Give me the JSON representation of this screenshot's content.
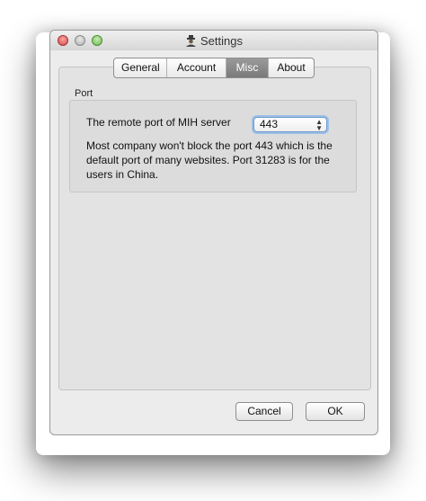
{
  "window": {
    "title": "Settings",
    "title_icon": "spy-icon"
  },
  "tabs": [
    {
      "label": "General",
      "active": false
    },
    {
      "label": "Account",
      "active": false
    },
    {
      "label": "Misc",
      "active": true
    },
    {
      "label": "About",
      "active": false
    }
  ],
  "port_group": {
    "title": "Port",
    "field_label": "The remote port of MIH server",
    "selected_port": "443",
    "description": "Most company won't block the port 443 which is the default port of many websites. Port 31283 is for the users in China."
  },
  "buttons": {
    "cancel": "Cancel",
    "ok": "OK"
  },
  "colors": {
    "active_tab": "#8a8a8a",
    "focus_ring": "#9cc0e8",
    "close_button": "#d7484a",
    "zoom_button": "#6cbc47"
  }
}
